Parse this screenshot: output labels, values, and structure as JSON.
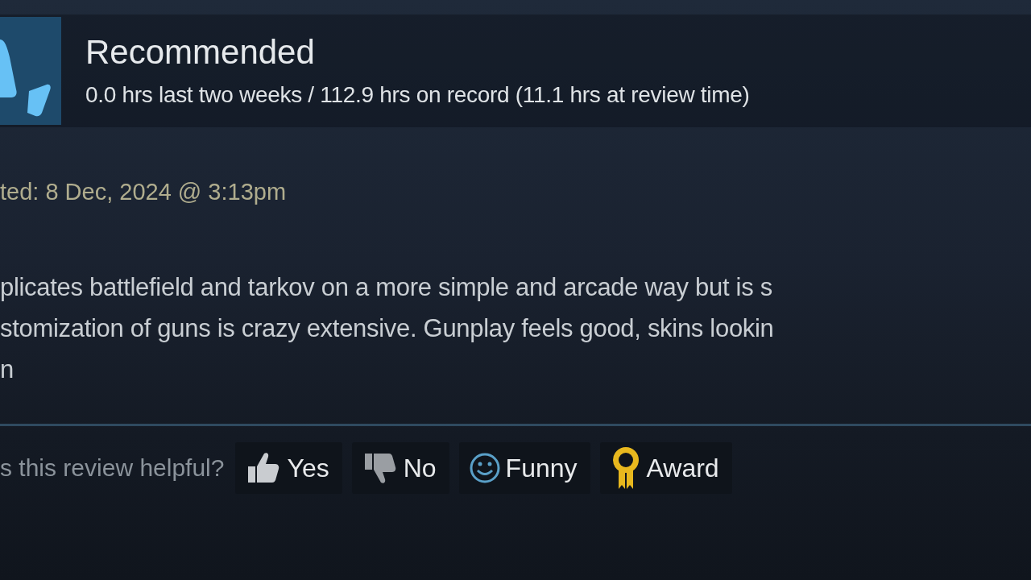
{
  "review": {
    "verdict": "Recommended",
    "hours": "0.0 hrs last two weeks / 112.9 hrs on record (11.1 hrs at review time)",
    "posted": "ted: 8 Dec, 2024 @ 3:13pm",
    "body_lines": [
      "plicates battlefield and tarkov on a more simple and arcade way but is s",
      "stomization of guns is crazy extensive. Gunplay feels good, skins lookin",
      "n"
    ]
  },
  "helpful": {
    "prompt": "s this review helpful?",
    "buttons": [
      {
        "kind": "yes",
        "label": "Yes"
      },
      {
        "kind": "no",
        "label": "No"
      },
      {
        "kind": "funny",
        "label": "Funny"
      },
      {
        "kind": "award",
        "label": "Award"
      }
    ]
  }
}
